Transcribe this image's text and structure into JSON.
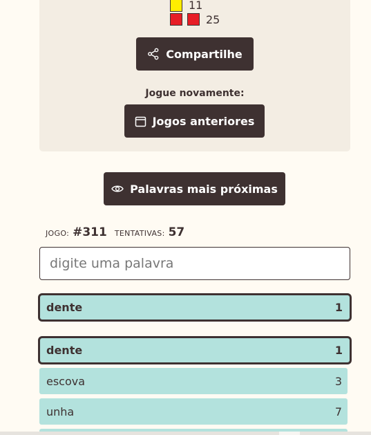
{
  "result": {
    "rows": [
      {
        "colors": [
          "yellow"
        ],
        "count": "11"
      },
      {
        "colors": [
          "red",
          "red"
        ],
        "count": "25"
      }
    ],
    "colors": {
      "yellow": "#ffed00",
      "red": "#e71d26",
      "bg": "#f3ede3"
    }
  },
  "buttons": {
    "share_label": "Compartilhe",
    "share_icon": "share-icon",
    "play_again_label": "Jogue novamente:",
    "previous_games_label": "Jogos anteriores",
    "previous_games_icon": "calendar-icon",
    "closest_words_label": "Palavras mais próximas",
    "closest_words_icon": "eye-icon"
  },
  "game_info": {
    "game_label": "JOGO:",
    "game_value": "#311",
    "attempts_label": "TENTATIVAS:",
    "attempts_value": "57"
  },
  "input": {
    "placeholder": "digite uma palavra",
    "value": ""
  },
  "current_guess": {
    "word": "dente",
    "rank": "1"
  },
  "guesses": [
    {
      "word": "dente",
      "rank": "1",
      "highlight": true
    },
    {
      "word": "escova",
      "rank": "3",
      "highlight": false
    },
    {
      "word": "unha",
      "rank": "7",
      "highlight": false
    }
  ],
  "theme": {
    "dark": "#3e3131",
    "page_bg": "#fffbf3",
    "row_bg": "#b3e2dd"
  }
}
